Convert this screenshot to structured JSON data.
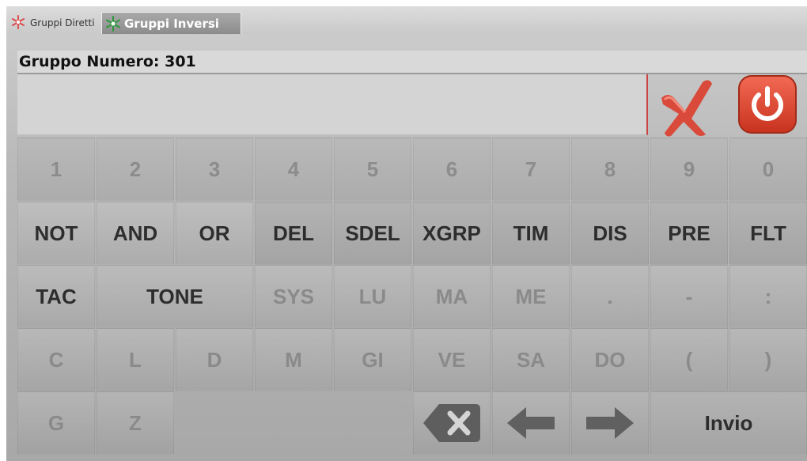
{
  "tabs": [
    {
      "label": "Gruppi Diretti",
      "active": false,
      "icon": "snowflake-icon",
      "icon_color": "#d44"
    },
    {
      "label": "Gruppi Inversi",
      "active": true,
      "icon": "snowflake-icon",
      "icon_color": "#2a9a3a"
    }
  ],
  "header": {
    "group_label": "Gruppo Numero: 301",
    "entry_value": ""
  },
  "actions": {
    "clear_icon": "x-mark-icon",
    "power_icon": "power-icon",
    "accent": "#e04a3a"
  },
  "keypad": {
    "digits": [
      "1",
      "2",
      "3",
      "4",
      "5",
      "6",
      "7",
      "8",
      "9",
      "0"
    ],
    "commands": [
      "NOT",
      "AND",
      "OR",
      "DEL",
      "SDEL",
      "XGRP",
      "TIM",
      "DIS",
      "PRE",
      "FLT"
    ],
    "row3": [
      "TAC",
      "TONE",
      "SYS",
      "LU",
      "MA",
      "ME",
      ".",
      "-",
      ":"
    ],
    "row4": [
      "C",
      "L",
      "D",
      "M",
      "GI",
      "VE",
      "SA",
      "DO",
      "(",
      ")"
    ],
    "row5": [
      "G",
      "Z"
    ],
    "enter_label": "Invio",
    "backspace_icon": "backspace-icon",
    "left_icon": "arrow-left-icon",
    "right_icon": "arrow-right-icon"
  }
}
